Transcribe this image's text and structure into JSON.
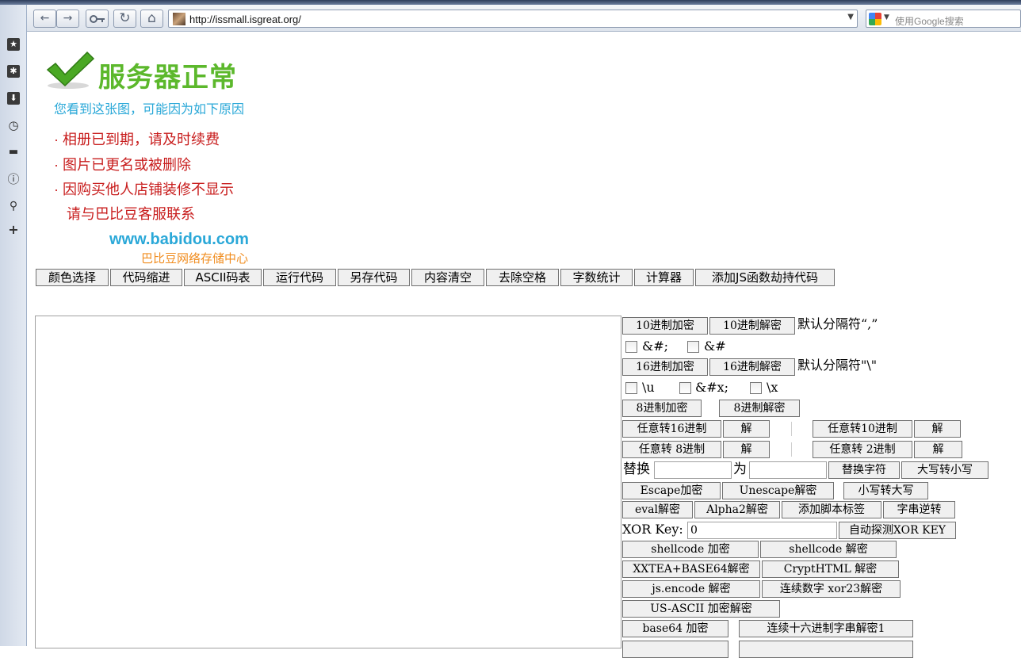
{
  "browser": {
    "url": "http://issmall.isgreat.org/",
    "search_placeholder": "使用Google搜索",
    "back_icon": "←",
    "forward_icon": "→",
    "key_icon": "key-icon",
    "reload_icon": "↻",
    "home_icon": "⌂",
    "drop": "▼"
  },
  "banner": {
    "title": "服务器正常",
    "subtitle": "您看到这张图，可能因为如下原因",
    "reasons": [
      "· 相册已到期，请及时续费",
      "· 图片已更名或被删除",
      "· 因购买他人店铺装修不显示"
    ],
    "contact": "请与巴比豆客服联系",
    "domain": "www.babidou.com",
    "company": "巴比豆网络存储中心"
  },
  "toolbar": [
    "颜色选择",
    "代码缩进",
    "ASCII码表",
    "运行代码",
    "另存代码",
    "内容清空",
    "去除空格",
    "字数统计",
    "计算器",
    "添加JS函数劫持代码"
  ],
  "panel": {
    "dec_enc": "10进制加密",
    "dec_dec": "10进制解密",
    "dec_note": "默认分隔符“,”",
    "cb_amp_hash_semi": "&#;",
    "cb_amp_hash": "&#",
    "hex_enc": "16进制加密",
    "hex_dec": "16进制解密",
    "hex_note": "默认分隔符\"\\\"",
    "cb_u": "\\u",
    "cb_amp_x": "&#x;",
    "cb_x": "\\x",
    "oct_enc": "8进制加密",
    "oct_dec": "8进制解密",
    "any16": "任意转16进制",
    "any16_dec": "解",
    "any10": "任意转10进制",
    "any10_dec": "解",
    "any8": "任意转 8进制",
    "any8_dec": "解",
    "any2": "任意转 2进制",
    "any2_dec": "解",
    "replace_label": "替换",
    "for_label": "为",
    "replace_btn": "替换字符",
    "upper_to_lower": "大写转小写",
    "escape": "Escape加密",
    "unescape": "Unescape解密",
    "lower_to_upper": "小写转大写",
    "eval_dec": "eval解密",
    "alpha2_dec": "Alpha2解密",
    "add_script": "添加脚本标签",
    "reverse": "字串逆转",
    "xor_label": "XOR Key:",
    "xor_value": "0",
    "xor_detect": "自动探测XOR KEY",
    "shell_enc": "shellcode 加密",
    "shell_dec": "shellcode 解密",
    "xxtea": "XXTEA+BASE64解密",
    "crypthtml": "CryptHTML 解密",
    "jsencode": "js.encode 解密",
    "xor23": "连续数字 xor23解密",
    "usascii": "US-ASCII 加密解密",
    "base64": "base64 加密",
    "hexstr1": "连续十六进制字串解密1"
  }
}
